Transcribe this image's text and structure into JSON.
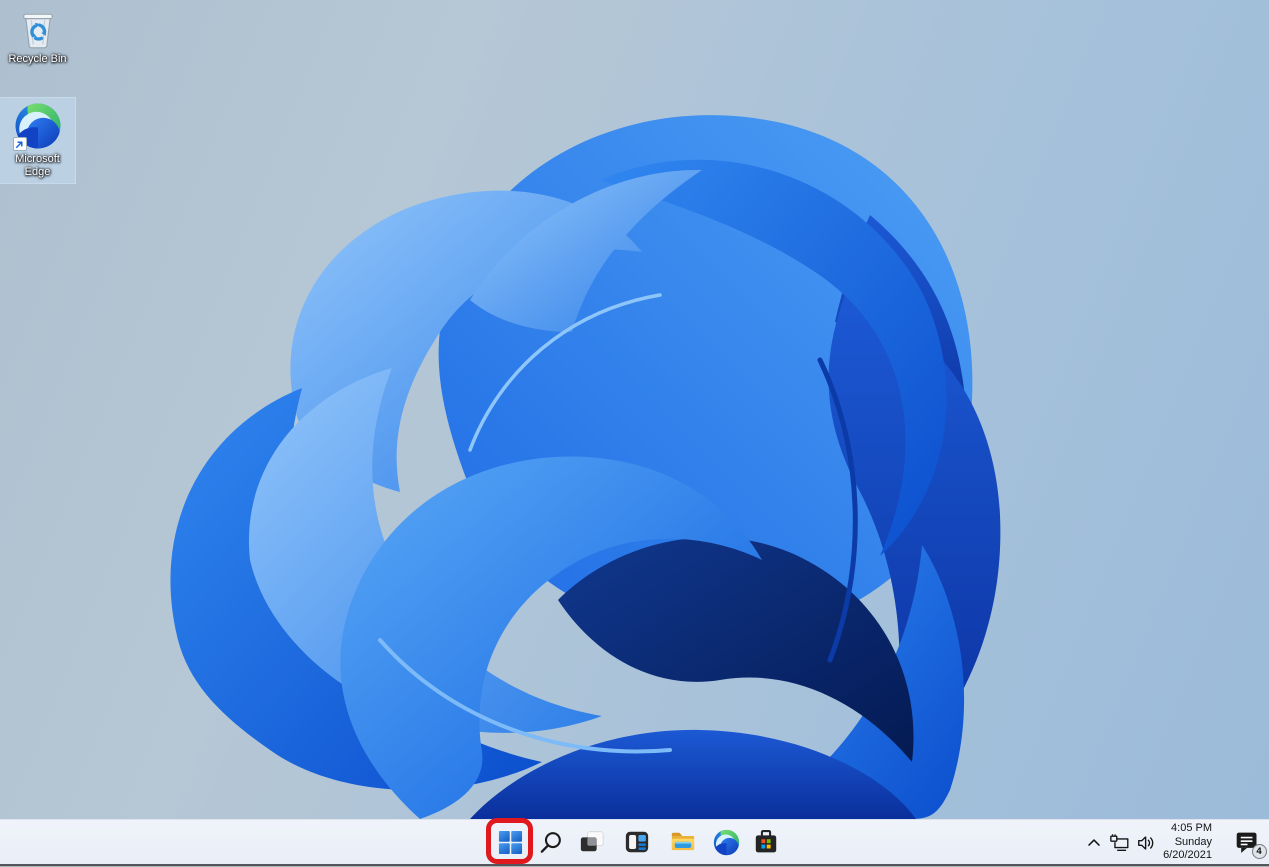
{
  "desktop": {
    "wallpaper": "windows-11-bloom",
    "icons": [
      {
        "label": "Recycle Bin",
        "selected": false
      },
      {
        "label": "Microsoft Edge",
        "selected": true
      }
    ]
  },
  "taskbar": {
    "buttons": [
      {
        "name": "start"
      },
      {
        "name": "search"
      },
      {
        "name": "task-view"
      },
      {
        "name": "widgets"
      },
      {
        "name": "file-explorer"
      },
      {
        "name": "microsoft-edge"
      },
      {
        "name": "microsoft-store"
      }
    ],
    "tray": {
      "icons": [
        "chevron-up",
        "network",
        "volume"
      ],
      "clock": {
        "time": "4:05 PM",
        "day": "Sunday",
        "date": "6/20/2021"
      },
      "notifications": {
        "badge_count": "4"
      }
    }
  },
  "annotation": {
    "shape": "rounded-rectangle",
    "color": "#e0191f",
    "target": "start-button"
  },
  "colors": {
    "taskbar_bg": "#edf1f8",
    "bloom_bright": "#2f86ee",
    "bloom_deep": "#092f86",
    "background_left": "#aebfcf",
    "background_right": "#9bbbda"
  }
}
